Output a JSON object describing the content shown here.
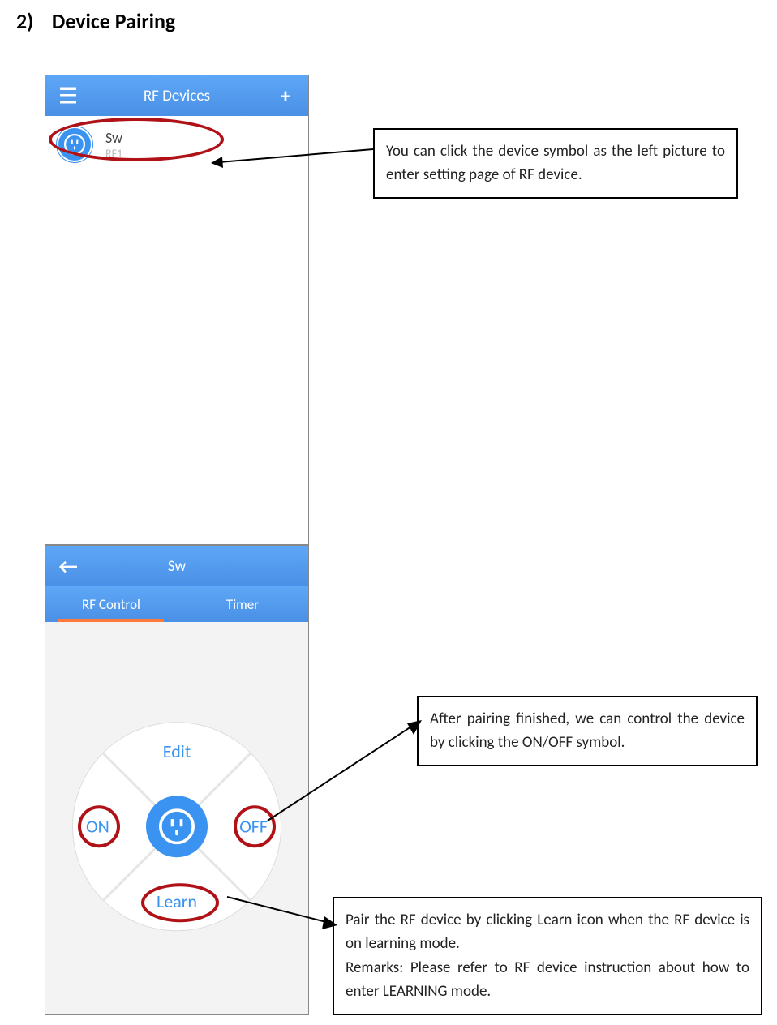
{
  "heading": {
    "number": "2)",
    "title": "Device Pairing"
  },
  "screenshot1": {
    "appbar_title": "RF Devices",
    "device": {
      "name": "Sw",
      "id": "RF1"
    }
  },
  "screenshot2": {
    "appbar_title": "Sw",
    "tabs": {
      "left": "RF Control",
      "right": "Timer"
    },
    "pad": {
      "edit": "Edit",
      "learn": "Learn",
      "on": "ON",
      "off": "OFF"
    }
  },
  "annotations": {
    "a1": "You can click the device symbol as the left picture to enter setting page of RF device.",
    "a2": "After pairing finished, we can control the device by clicking the ON/OFF symbol.",
    "a3_line1": "Pair the RF device by clicking Learn icon when the RF device is on learning mode.",
    "a3_line2": "Remarks: Please refer to RF device instruction about how to enter LEARNING mode."
  }
}
